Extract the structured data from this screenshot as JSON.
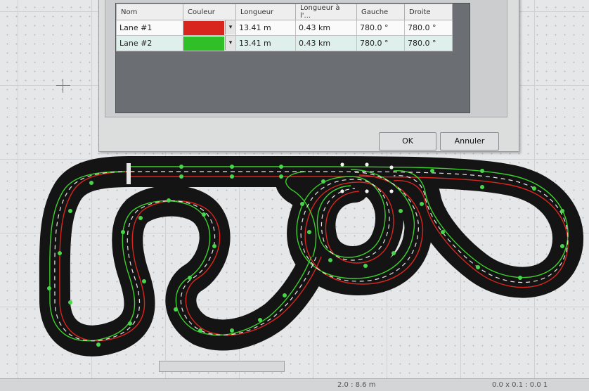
{
  "lane_table": {
    "headers": [
      "Nom",
      "Couleur",
      "Longueur",
      "Longueur à l'...",
      "Gauche",
      "Droite"
    ],
    "rows": [
      {
        "name": "Lane #1",
        "color": "#d8251e",
        "length": "13.41 m",
        "length_to": "0.43 km",
        "left": "780.0 °",
        "right": "780.0 °"
      },
      {
        "name": "Lane #2",
        "color": "#2fbf26",
        "length": "13.41 m",
        "length_to": "0.43 km",
        "left": "780.0 °",
        "right": "780.0 °"
      }
    ]
  },
  "buttons": {
    "ok": "OK",
    "cancel": "Annuler"
  },
  "dropdown_icon": "▾",
  "status": {
    "coords": "2.0 : 8.6 m",
    "extra": "0.0 x 0.1 : 0.0 1"
  },
  "colors": {
    "track": "#141414",
    "lane_red": "#d8251e",
    "lane_green": "#3ad12a",
    "centerline": "#e8e8e8",
    "node": "#49d64a"
  }
}
